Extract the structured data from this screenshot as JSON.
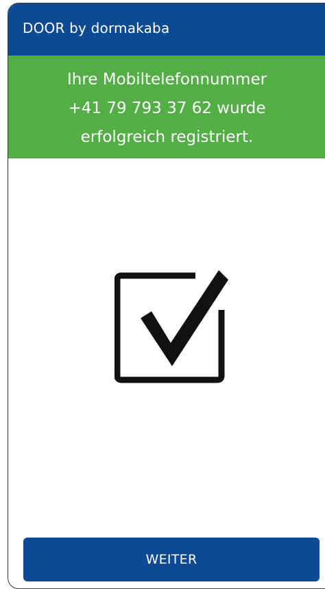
{
  "header": {
    "title": "DOOR by dormakaba"
  },
  "banner": {
    "lines": [
      "Ihre Mobiltelefonnummer",
      "+41 79 793 37 62 wurde",
      "erfolgreich registriert."
    ]
  },
  "content": {
    "icon": "checkbox-checked-icon"
  },
  "actions": {
    "continue_label": "WEITER"
  },
  "colors": {
    "header": "#0d4a95",
    "banner": "#53ae46",
    "button": "#0d4a95"
  }
}
